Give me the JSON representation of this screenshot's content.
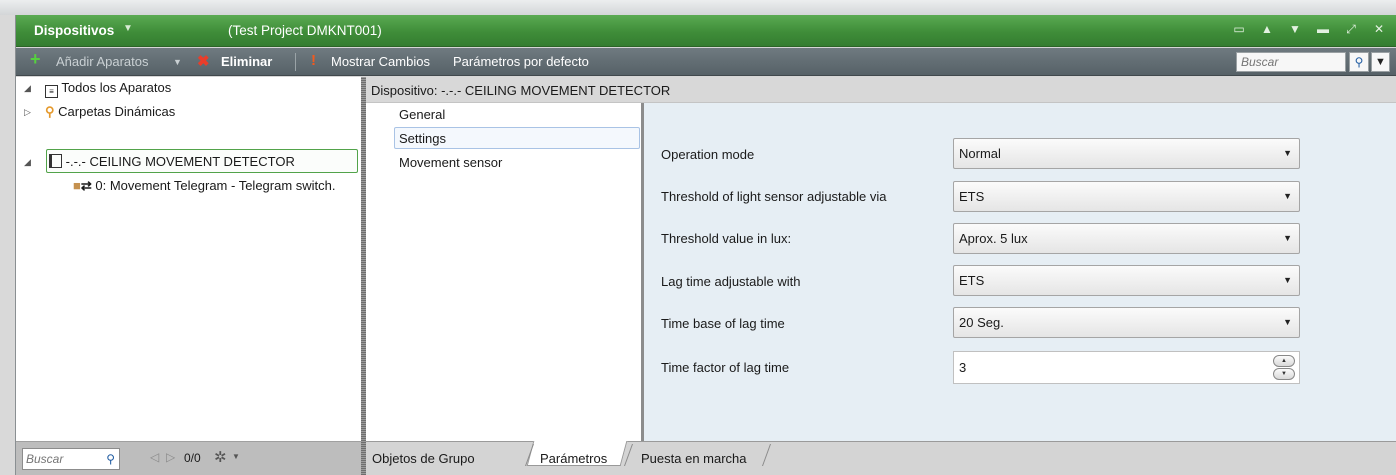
{
  "window": {
    "title": "Dispositivos",
    "project": "(Test Project DMKNT001)"
  },
  "toolbar": {
    "add_label": "Añadir Aparatos",
    "delete_label": "Eliminar",
    "show_changes_label": "Mostrar Cambios",
    "defaults_label": "Parámetros por defecto",
    "search_placeholder": "Buscar"
  },
  "tree": {
    "all_devices": "Todos los Aparatos",
    "dynamic_folders": "Carpetas Dinámicas",
    "device": "-.-.- CEILING MOVEMENT DETECTOR",
    "group_object": "0: Movement Telegram - Telegram switch."
  },
  "left_bottom": {
    "search_placeholder": "Buscar",
    "counter": "0/0"
  },
  "right_header": {
    "device_title": "Dispositivo: -.-.- CEILING MOVEMENT DETECTOR"
  },
  "nav": {
    "items": [
      "General",
      "Settings",
      "Movement sensor"
    ],
    "selected": "Settings"
  },
  "params": [
    {
      "label": "Operation mode",
      "value": "Normal"
    },
    {
      "label": "Threshold of light sensor adjustable via",
      "value": "ETS"
    },
    {
      "label": "Threshold value in lux:",
      "value": "Aprox. 5 lux"
    },
    {
      "label": "Lag time adjustable with",
      "value": "ETS"
    },
    {
      "label": "Time base of lag time",
      "value": "20 Seg."
    },
    {
      "label": "Time factor of lag time",
      "value": "3"
    }
  ],
  "tabs": [
    "Objetos de Grupo",
    "Parámetros",
    "Puesta en marcha"
  ],
  "active_tab": "Parámetros",
  "colors": {
    "titlebar": "#4a9a43",
    "toolbar": "#5f6a70",
    "selection_border": "#52a34a",
    "params_bg": "#e6eef4"
  }
}
